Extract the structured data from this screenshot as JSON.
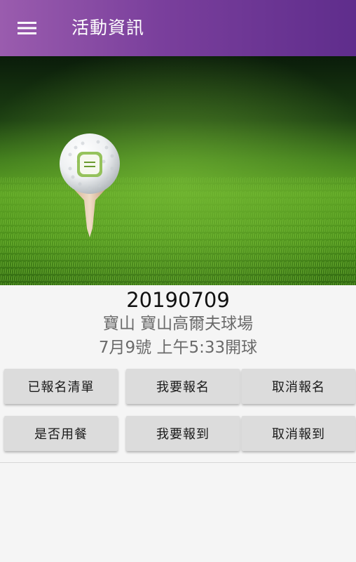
{
  "appbar": {
    "title": "活動資訊",
    "menu_icon": "hamburger-menu-icon",
    "gradient": [
      "#9a5cae",
      "#5f2d8c"
    ]
  },
  "hero": {
    "image": "golf-ball-on-tee-grass-photo"
  },
  "event": {
    "date": "20190709",
    "location": "寶山 寶山高爾夫球場",
    "tee_time": "7月9號 上午5:33開球"
  },
  "actions": {
    "registered_list": "已報名清單",
    "register": "我要報名",
    "cancel_register": "取消報名",
    "meal": "是否用餐",
    "check_in": "我要報到",
    "cancel_check_in": "取消報到"
  }
}
